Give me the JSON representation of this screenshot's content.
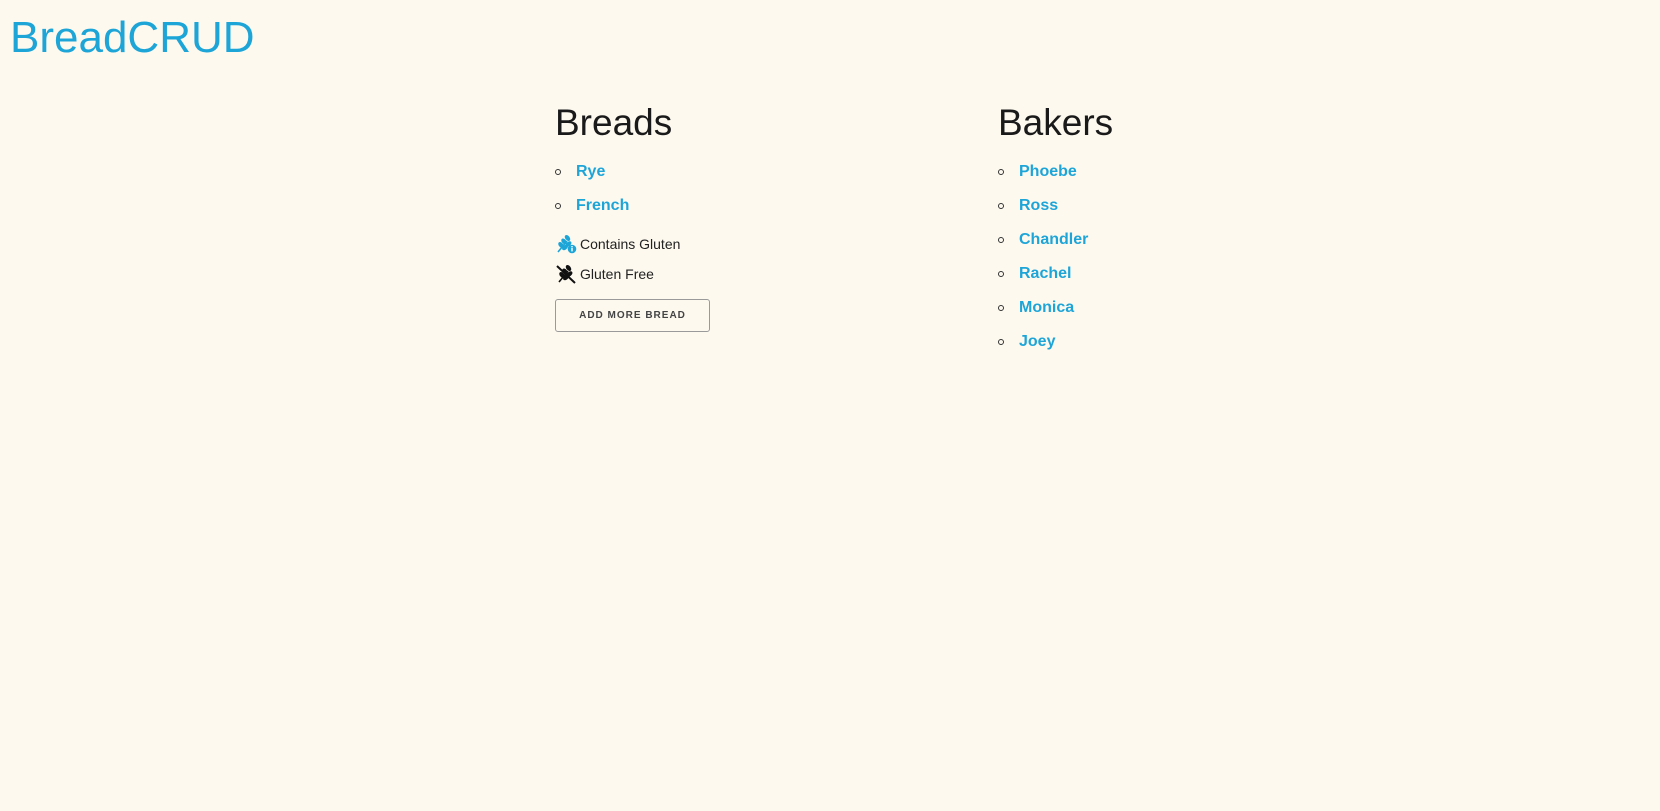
{
  "site": {
    "title": "BreadCRUD"
  },
  "breads": {
    "heading": "Breads",
    "items": [
      {
        "label": "Rye"
      },
      {
        "label": "French"
      }
    ],
    "legend": [
      {
        "icon": "gluten-icon",
        "label": "Contains Gluten"
      },
      {
        "icon": "gluten-free-icon",
        "label": "Gluten Free"
      }
    ],
    "add_button_label": "Add More Bread"
  },
  "bakers": {
    "heading": "Bakers",
    "items": [
      {
        "label": "Phoebe"
      },
      {
        "label": "Ross"
      },
      {
        "label": "Chandler"
      },
      {
        "label": "Rachel"
      },
      {
        "label": "Monica"
      },
      {
        "label": "Joey"
      }
    ]
  },
  "colors": {
    "accent": "#1ea5d8",
    "background": "#fdf9ef",
    "text": "#222222"
  }
}
